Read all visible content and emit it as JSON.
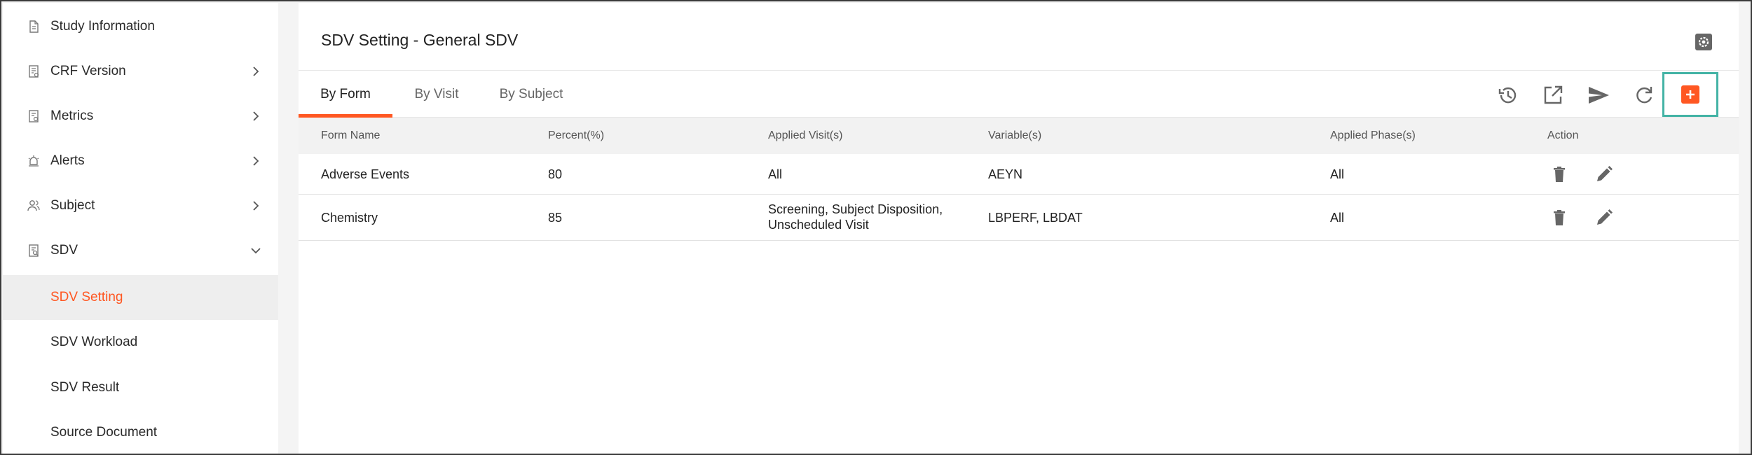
{
  "sidebar": {
    "items": [
      {
        "label": "Study Information",
        "icon": "document-icon"
      },
      {
        "label": "CRF Version",
        "icon": "form-icon"
      },
      {
        "label": "Metrics",
        "icon": "metrics-icon"
      },
      {
        "label": "Alerts",
        "icon": "alarm-icon"
      },
      {
        "label": "Subject",
        "icon": "users-icon"
      },
      {
        "label": "SDV",
        "icon": "sdv-icon"
      }
    ],
    "sub_items": [
      {
        "label": "SDV Setting"
      },
      {
        "label": "SDV Workload"
      },
      {
        "label": "SDV Result"
      },
      {
        "label": "Source Document"
      }
    ]
  },
  "main": {
    "title": "SDV Setting - General SDV",
    "tabs": [
      {
        "label": "By Form"
      },
      {
        "label": "By Visit"
      },
      {
        "label": "By Subject"
      }
    ],
    "toolbar_icons": [
      "history-icon",
      "export-icon",
      "send-icon",
      "refresh-icon",
      "add-icon"
    ],
    "table": {
      "headers": [
        "Form Name",
        "Percent(%)",
        "Applied Visit(s)",
        "Variable(s)",
        "Applied Phase(s)",
        "Action"
      ],
      "rows": [
        {
          "form_name": "Adverse Events",
          "percent": "80",
          "visit_line1": "All",
          "visit_line2": "",
          "variables": "AEYN",
          "phases": "All"
        },
        {
          "form_name": "Chemistry",
          "percent": "85",
          "visit_line1": "Screening, Subject Disposition,",
          "visit_line2": "Unscheduled Visit",
          "variables": "LBPERF, LBDAT",
          "phases": "All"
        }
      ]
    }
  },
  "colors": {
    "accent": "#ff5722",
    "highlight": "#43b3a5",
    "icon_gray": "#666666"
  }
}
